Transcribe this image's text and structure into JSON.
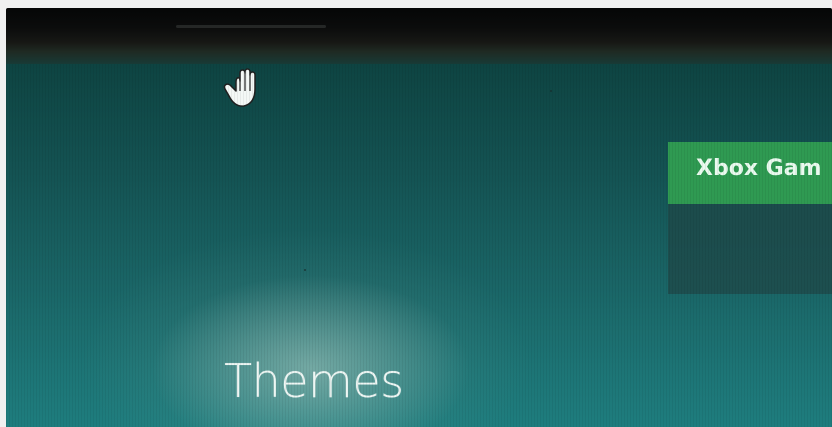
{
  "heading": "Themes",
  "tile": {
    "title": "Xbox Gam",
    "accent": "#2f9a52"
  },
  "cursor": {
    "icon": "hand-cursor-icon"
  },
  "colors": {
    "background": "#145353",
    "bezel": "#0b0c0c",
    "heading_text": "#eef7f4"
  }
}
